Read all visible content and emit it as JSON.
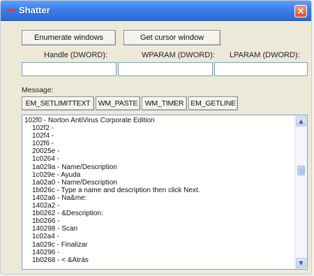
{
  "window": {
    "title": "Shatter"
  },
  "toolbar": {
    "enumerate_label": "Enumerate windows",
    "cursor_label": "Get cursor window"
  },
  "params": {
    "handle_label": "Handle (DWORD):",
    "wparam_label": "WPARAM (DWORD):",
    "lparam_label": "LPARAM (DWORD):",
    "handle_value": "",
    "wparam_value": "",
    "lparam_value": ""
  },
  "message": {
    "label": "Message:",
    "buttons": [
      "EM_SETLIMITTEXT",
      "WM_PASTE",
      "WM_TIMER",
      "EM_GETLINE"
    ]
  },
  "list": {
    "items": [
      "102f0 - Norton AntiVirus Corporate Edition",
      "102f2 -",
      "102f4 -",
      "102f6 -",
      "20025e -",
      "1c0264 -",
      "1a029a - Name/Description",
      "1c029e - Ayuda",
      "1a02a0 - Name/Description",
      "1b026c - Type a name and description then click Next.",
      "1402a6 - Na&me:",
      "1402a2 -",
      "1b0262 - &Description:",
      "1b0266 -",
      "140298 - Scan",
      "1c02a4 -",
      "1a029c - Finalizar",
      "140296 -",
      "1b0268 - < &Atrás"
    ]
  },
  "icons": {
    "close": "close-icon",
    "app": "app-icon",
    "scroll_up": "scroll-up-icon",
    "scroll_down": "scroll-down-icon"
  },
  "colors": {
    "titlebar": "#3a7fe8",
    "close": "#d9532c",
    "window_bg": "#ece9d8",
    "field_border": "#7f9db9"
  }
}
